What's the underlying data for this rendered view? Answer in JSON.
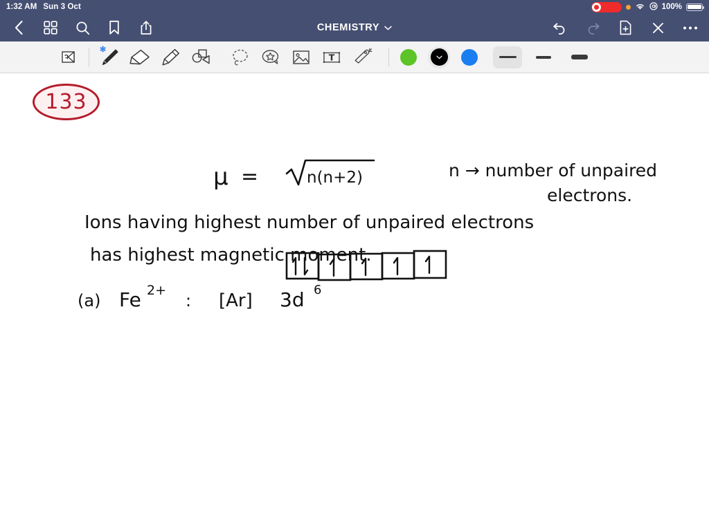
{
  "status_bar": {
    "time": "1:32 AM",
    "date": "Sun 3 Oct",
    "battery_percent": "100%",
    "icons": {
      "recording": "record-indicator",
      "privacy_dot": "orange-privacy-dot",
      "wifi": "wifi-icon",
      "location": "location-services-icon",
      "battery": "battery-icon"
    }
  },
  "nav_bar": {
    "title": "CHEMISTRY",
    "title_chevron": "chevron-down-icon",
    "left_buttons": [
      {
        "name": "back-button",
        "icon": "chevron-left-icon"
      },
      {
        "name": "library-grid-button",
        "icon": "grid-icon"
      },
      {
        "name": "search-button",
        "icon": "search-icon"
      },
      {
        "name": "bookmark-button",
        "icon": "bookmark-icon"
      },
      {
        "name": "share-button",
        "icon": "share-icon"
      }
    ],
    "right_buttons": [
      {
        "name": "undo-button",
        "icon": "undo-arrow-icon",
        "enabled": true
      },
      {
        "name": "redo-button",
        "icon": "redo-arrow-icon",
        "enabled": false
      },
      {
        "name": "new-page-button",
        "icon": "document-plus-icon"
      },
      {
        "name": "close-button",
        "icon": "close-x-icon"
      },
      {
        "name": "more-options-button",
        "icon": "ellipsis-icon"
      }
    ]
  },
  "toolbar": {
    "tools": [
      {
        "name": "page-flip-tool",
        "icon": "page-flip-icon",
        "selected": false
      },
      {
        "name": "pen-tool",
        "icon": "pen-icon",
        "selected": true,
        "bluetooth": "✻"
      },
      {
        "name": "eraser-tool",
        "icon": "eraser-icon",
        "selected": false
      },
      {
        "name": "highlighter-tool",
        "icon": "highlighter-icon",
        "selected": false
      },
      {
        "name": "shapes-tool",
        "icon": "shapes-icon",
        "selected": false
      },
      {
        "name": "lasso-tool",
        "icon": "lasso-icon",
        "selected": false
      },
      {
        "name": "sticker-tool",
        "icon": "sticker-star-icon",
        "selected": false
      },
      {
        "name": "image-tool",
        "icon": "image-icon",
        "selected": false
      },
      {
        "name": "text-tool",
        "icon": "text-box-icon",
        "selected": false
      },
      {
        "name": "magic-wand-tool",
        "icon": "magic-wand-icon",
        "selected": false
      }
    ],
    "colors": [
      {
        "name": "color-swatch-green",
        "hex": "#5cc427",
        "selected": false
      },
      {
        "name": "color-swatch-black",
        "hex": "#000000",
        "selected": true
      },
      {
        "name": "color-swatch-blue",
        "hex": "#1a7ef0",
        "selected": false
      }
    ],
    "stroke_widths": [
      {
        "name": "stroke-width-thin",
        "selected": true,
        "thickness": 3
      },
      {
        "name": "stroke-width-medium",
        "selected": false,
        "thickness": 4
      },
      {
        "name": "stroke-width-thick",
        "selected": false,
        "thickness": 7
      }
    ]
  },
  "note": {
    "problem_number": "133",
    "formula": {
      "mu": "μ",
      "equals": "=",
      "radicand": "n(n+2)"
    },
    "legend_line1": "n → number of unpaired",
    "legend_line2": "electrons.",
    "body_line1": "Ions  having   highest   number  of   unpaired  electrons",
    "body_line2": "has    highest   magnetic  moment.",
    "answer": {
      "label": "(a)",
      "species": "Fe",
      "charge": "2+",
      "colon": ":",
      "config_core": "[Ar]",
      "config_sub": "3d",
      "config_exp": "6"
    },
    "orbital_boxes": [
      {
        "name": "orbital-box-1",
        "electrons": "up-down"
      },
      {
        "name": "orbital-box-2",
        "electrons": "up"
      },
      {
        "name": "orbital-box-3",
        "electrons": "up"
      },
      {
        "name": "orbital-box-4",
        "electrons": "up"
      },
      {
        "name": "orbital-box-5",
        "electrons": "up"
      }
    ]
  }
}
